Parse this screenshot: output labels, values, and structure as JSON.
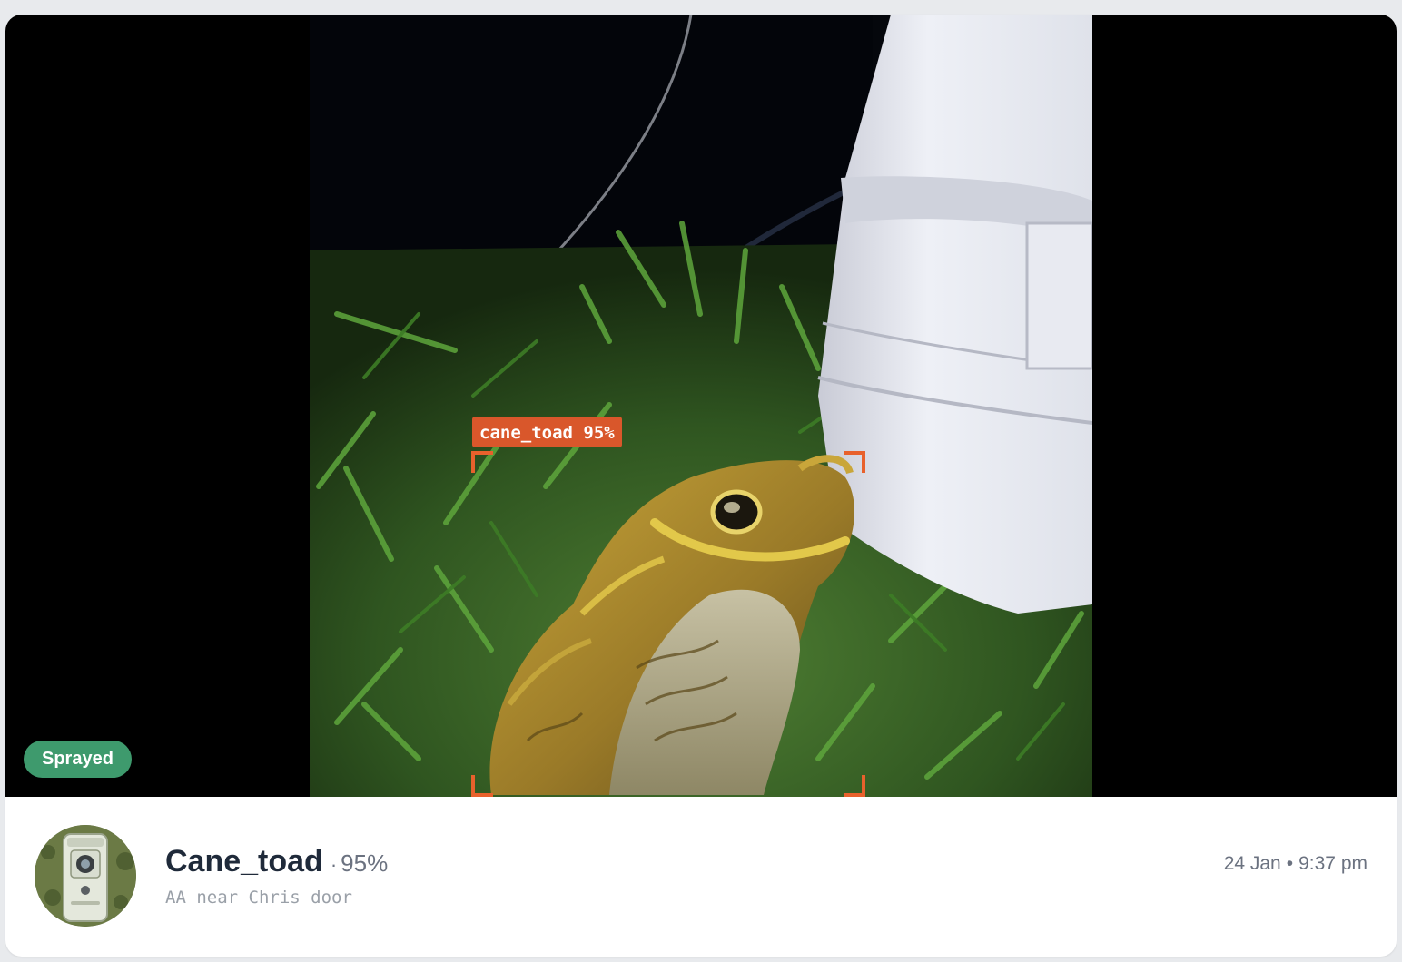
{
  "detection": {
    "overlay_label": "cane_toad 95%",
    "status_badge": "Sprayed"
  },
  "info": {
    "species": "Cane_toad",
    "separator": "·",
    "confidence": "95%",
    "location": "AA near Chris door",
    "date": "24 Jan",
    "time_separator": "•",
    "time": "9:37 pm"
  },
  "colors": {
    "box_accent": "#e8612c",
    "badge_green": "#3e9a6d",
    "title_text": "#1f2a3a"
  },
  "icons": {
    "avatar": "trail-camera-icon"
  }
}
